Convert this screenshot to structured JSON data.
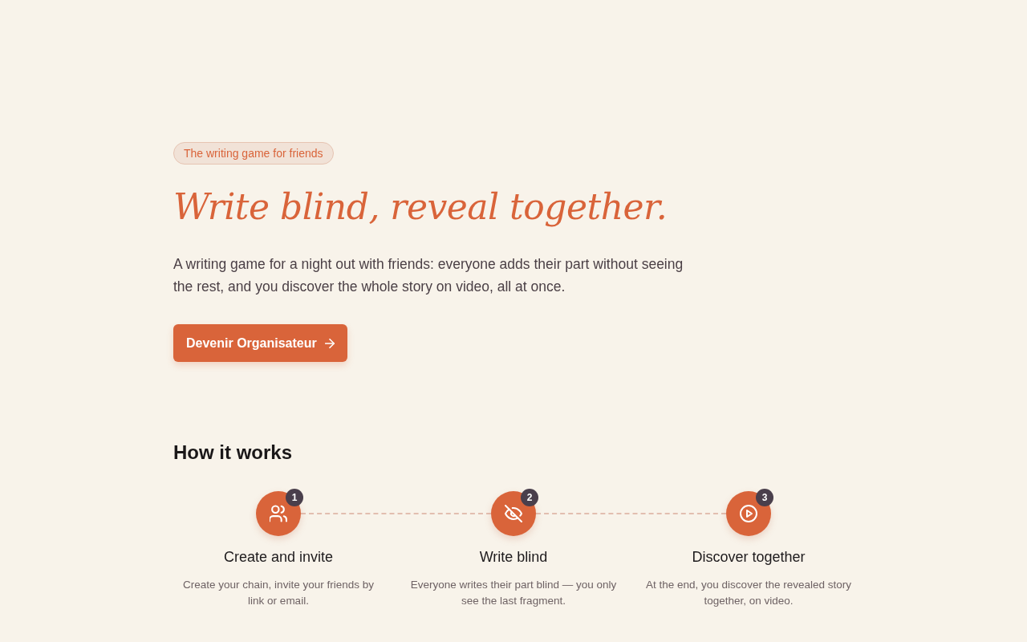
{
  "hero": {
    "eyebrow": "The writing game for friends",
    "title": "Write blind, reveal together.",
    "lead": "A writing game for a night out with friends: everyone adds their part without seeing the rest, and you discover the whole story on video, all at once.",
    "cta": {
      "label": "Devenir Organisateur"
    }
  },
  "how_it_works": {
    "heading": "How it works",
    "steps": [
      {
        "number": "1",
        "title": "Create and invite",
        "description": "Create your chain, invite your friends by link or email."
      },
      {
        "number": "2",
        "title": "Write blind",
        "description": "Everyone writes their part blind — you only see the last fragment."
      },
      {
        "number": "3",
        "title": "Discover together",
        "description": "At the end, you discover the revealed story together, on video."
      }
    ]
  }
}
